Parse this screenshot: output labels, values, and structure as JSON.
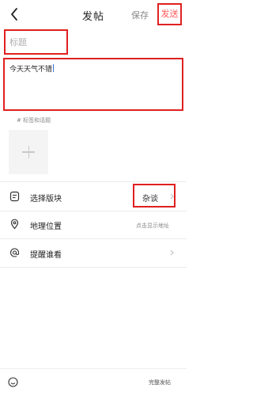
{
  "header": {
    "title": "发帖",
    "save_label": "保存",
    "send_label": "发送",
    "back_icon": "back-arrow-icon"
  },
  "compose": {
    "title_placeholder": "标题",
    "title_value": "",
    "content": "今天天气不错",
    "tags_link": "# 标签和话题",
    "upload_icon": "plus-icon"
  },
  "options": [
    {
      "label": "选择版块",
      "value": "杂谈",
      "icon": "board-icon"
    },
    {
      "label": "地理位置",
      "hint": "点击显示地址",
      "icon": "location-pin-icon"
    },
    {
      "label": "提醒谁看",
      "icon": "at-mention-icon"
    }
  ],
  "footer": {
    "emoji_icon": "smile-icon",
    "complete_label": "完整发帖"
  },
  "colors": {
    "annotation_red": "#e02020",
    "send_text": "#ff5a5a",
    "caret": "#3b74d9"
  }
}
